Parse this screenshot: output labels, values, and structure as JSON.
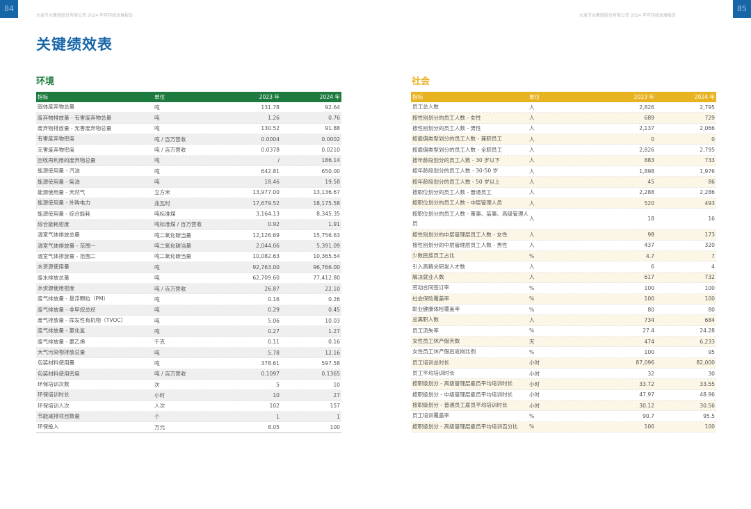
{
  "header": {
    "left_page_number": "84",
    "right_page_number": "85",
    "running_title": "大禹节水集团股份有限公司 2024 年可持续发展报告",
    "page_title": "关键绩效表"
  },
  "colors": {
    "blue": "#1766a8",
    "green": "#1e7a3f",
    "yellow": "#e8b321"
  },
  "environment": {
    "title": "环境",
    "columns": [
      "指标",
      "单位",
      "2023 年",
      "2024 年"
    ],
    "rows": [
      [
        "固体废弃物总量",
        "吨",
        "131.78",
        "92.64"
      ],
      [
        "废弃物排放量 - 有害废弃物总量",
        "吨",
        "1.26",
        "0.76"
      ],
      [
        "废弃物排放量 - 无害废弃物总量",
        "吨",
        "130.52",
        "91.88"
      ],
      [
        "有害废弃物密度",
        "吨 / 百万营收",
        "0.0004",
        "0.0002"
      ],
      [
        "无害废弃物密度",
        "吨 / 百万营收",
        "0.0378",
        "0.0210"
      ],
      [
        "回收再利用的废弃物总量",
        "吨",
        "/",
        "186.14"
      ],
      [
        "能源使用量 - 汽油",
        "吨",
        "642.81",
        "650.00"
      ],
      [
        "能源使用量 - 柴油",
        "吨",
        "18.46",
        "19.58"
      ],
      [
        "能源使用量 - 天然气",
        "立方米",
        "13,977.00",
        "13,136.67"
      ],
      [
        "能源使用量 - 外购电力",
        "兆瓦时",
        "17,679.52",
        "18,175.58"
      ],
      [
        "能源使用量 - 综合能耗",
        "吨标准煤",
        "3,164.13",
        "8,345.35"
      ],
      [
        "综合能耗密度",
        "吨标准煤 / 百万营收",
        "0.92",
        "1.91"
      ],
      [
        "温室气体排放总量",
        "吨二氧化碳当量",
        "12,126.69",
        "15,756.63"
      ],
      [
        "温室气体排放量 - 范围一",
        "吨二氧化碳当量",
        "2,044.06",
        "5,391.09"
      ],
      [
        "温室气体排放量 - 范围二",
        "吨二氧化碳当量",
        "10,082.63",
        "10,365.54"
      ],
      [
        "水资源使用量",
        "吨",
        "92,763.00",
        "96,766.00"
      ],
      [
        "废水排放总量",
        "吨",
        "62,709.60",
        "77,412.80"
      ],
      [
        "水资源使用密度",
        "吨 / 百万营收",
        "26.87",
        "22.10"
      ],
      [
        "废气排放量 - 悬浮颗粒（PM）",
        "吨",
        "0.16",
        "0.26"
      ],
      [
        "废气排放量 - 非甲烷总烃",
        "吨",
        "0.29",
        "0.45"
      ],
      [
        "废气排放量 - 挥发性有机物（TVOC）",
        "吨",
        "5.06",
        "10.03"
      ],
      [
        "废气排放量 - 氯化氢",
        "吨",
        "0.27",
        "1.27"
      ],
      [
        "废气排放量 - 氯乙烯",
        "千克",
        "0.11",
        "0.16"
      ],
      [
        "大气污染物排放总量",
        "吨",
        "5.78",
        "12.16"
      ],
      [
        "包装材料使用量",
        "吨",
        "378.61",
        "597.58"
      ],
      [
        "包装材料使用密度",
        "吨 / 百万营收",
        "0.1097",
        "0.1365"
      ],
      [
        "环保培训次数",
        "次",
        "5",
        "10"
      ],
      [
        "环保培训时长",
        "小时",
        "10",
        "27"
      ],
      [
        "环保培训人次",
        "人次",
        "102",
        "157"
      ],
      [
        "节能减排项目数量",
        "个",
        "1",
        "1"
      ],
      [
        "环保投入",
        "万元",
        "8.05",
        "100"
      ]
    ]
  },
  "society": {
    "title": "社会",
    "columns": [
      "指标",
      "单位",
      "2023 年",
      "2024 年"
    ],
    "rows": [
      [
        "员工总人数",
        "人",
        "2,826",
        "2,795"
      ],
      [
        "按性别划分的员工人数 - 女性",
        "人",
        "689",
        "729"
      ],
      [
        "按性别划分的员工人数 - 男性",
        "人",
        "2,137",
        "2,066"
      ],
      [
        "按雇佣类型划分的员工人数 - 兼职员工",
        "人",
        "0",
        "0"
      ],
      [
        "按雇佣类型划分的员工人数 - 全职员工",
        "人",
        "2,826",
        "2,795"
      ],
      [
        "按年龄段划分的员工人数 - 30 岁以下",
        "人",
        "883",
        "733"
      ],
      [
        "按年龄段划分的员工人数 - 30-50 岁",
        "人",
        "1,898",
        "1,976"
      ],
      [
        "按年龄段划分的员工人数 - 50 岁以上",
        "人",
        "45",
        "86"
      ],
      [
        "按职位划分的员工人数 - 普通员工",
        "人",
        "2,288",
        "2,286"
      ],
      [
        "按职位划分的员工人数 - 中层管理人员",
        "人",
        "520",
        "493"
      ],
      [
        "按职位划分的员工人数 - 董事、监事、高级管理人员",
        "人",
        "18",
        "16"
      ],
      [
        "按性别划分的中层管理层员工人数 - 女性",
        "人",
        "98",
        "173"
      ],
      [
        "按性别划分的中层管理层员工人数 - 男性",
        "人",
        "437",
        "320"
      ],
      [
        "少数民族员工占比",
        "%",
        "4.7",
        "7"
      ],
      [
        "引入高精尖研发人才数",
        "人",
        "6",
        "4"
      ],
      [
        "解决就业人数",
        "人",
        "617",
        "732"
      ],
      [
        "劳动合同签订率",
        "%",
        "100",
        "100"
      ],
      [
        "社会保险覆盖率",
        "%",
        "100",
        "100"
      ],
      [
        "职业健康体检覆盖率",
        "%",
        "80",
        "80"
      ],
      [
        "总离职人数",
        "人",
        "734",
        "684"
      ],
      [
        "员工流失率",
        "%",
        "27.4",
        "24.28"
      ],
      [
        "女性员工休产假天数",
        "天",
        "474",
        "6,233"
      ],
      [
        "女性员工休产假后返岗比例",
        "%",
        "100",
        "95"
      ],
      [
        "员工培训总时长",
        "小时",
        "87,096",
        "82,000"
      ],
      [
        "员工平均培训时长",
        "小时",
        "32",
        "30"
      ],
      [
        "按职级划分 - 高级管理层雇员平均培训时长",
        "小时",
        "33.72",
        "33.55"
      ],
      [
        "按职级划分 - 中级管理层雇员平均培训时长",
        "小时",
        "47.97",
        "48.96"
      ],
      [
        "按职级划分 - 普通员工雇员平均培训时长",
        "小时",
        "30.12",
        "30.56"
      ],
      [
        "员工培训覆盖率",
        "%",
        "90.7",
        "95.5"
      ],
      [
        "按职级划分 - 高级管理层雇员平均培训百分比",
        "%",
        "100",
        "100"
      ]
    ]
  }
}
